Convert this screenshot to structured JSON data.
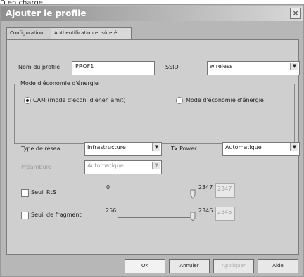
{
  "top_crop_text": "D en charge.",
  "window": {
    "title": "Ajouter le profile",
    "close_glyph": "✕"
  },
  "tabs": [
    {
      "label": "Configuration"
    },
    {
      "label": "Authentification et sûreté"
    }
  ],
  "config": {
    "profile_name_label": "Nom du profile",
    "profile_name_value": "PROF1",
    "ssid_label": "SSID",
    "ssid_value": "wireless",
    "power_group": {
      "title": "Mode d'économie d'énergie",
      "option1": "CAM (mode d'écon. d'ener. amit)",
      "option2": "Mode d'économie d'énergie"
    },
    "network_type_label": "Type de réseau",
    "network_type_value": "Infrastructure",
    "tx_power_label": "Tx Power",
    "tx_power_value": "Automatique",
    "preamble_label": "Préambule",
    "preamble_value": "Automatique",
    "rts_threshold_label": "Seuil RtS",
    "rts_min": "0",
    "rts_max": "2347",
    "rts_value": "2347",
    "frag_threshold_label": "Seuil de fragment",
    "frag_min": "256",
    "frag_max": "2346",
    "frag_value": "2346"
  },
  "buttons": {
    "ok": "OK",
    "cancel": "Annuler",
    "apply": "Appliquer",
    "help": "Aide"
  },
  "icons": {
    "dropdown": "chevron-down-icon",
    "close": "close-icon"
  }
}
